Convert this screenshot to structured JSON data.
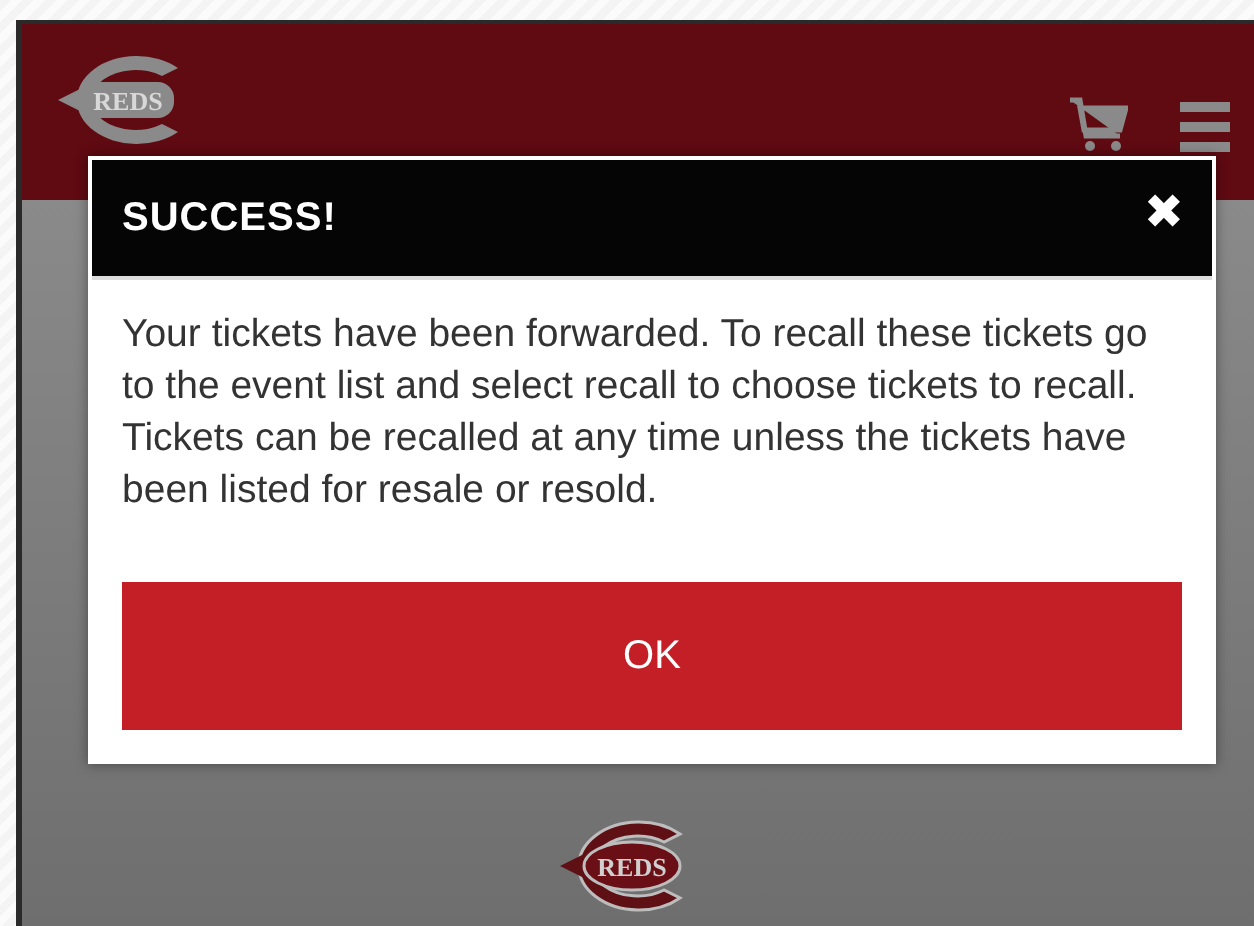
{
  "header": {
    "logo_text": "REDS"
  },
  "dialog": {
    "title": "SUCCESS!",
    "close": "✖",
    "message": "Your tickets have been forwarded. To recall these tickets go to the event list and select recall to choose tickets to recall. Tickets can be recalled at any time unless the tickets have been listed for resale or resold.",
    "button": "OK"
  },
  "footer": {
    "logo_text": "REDS"
  }
}
